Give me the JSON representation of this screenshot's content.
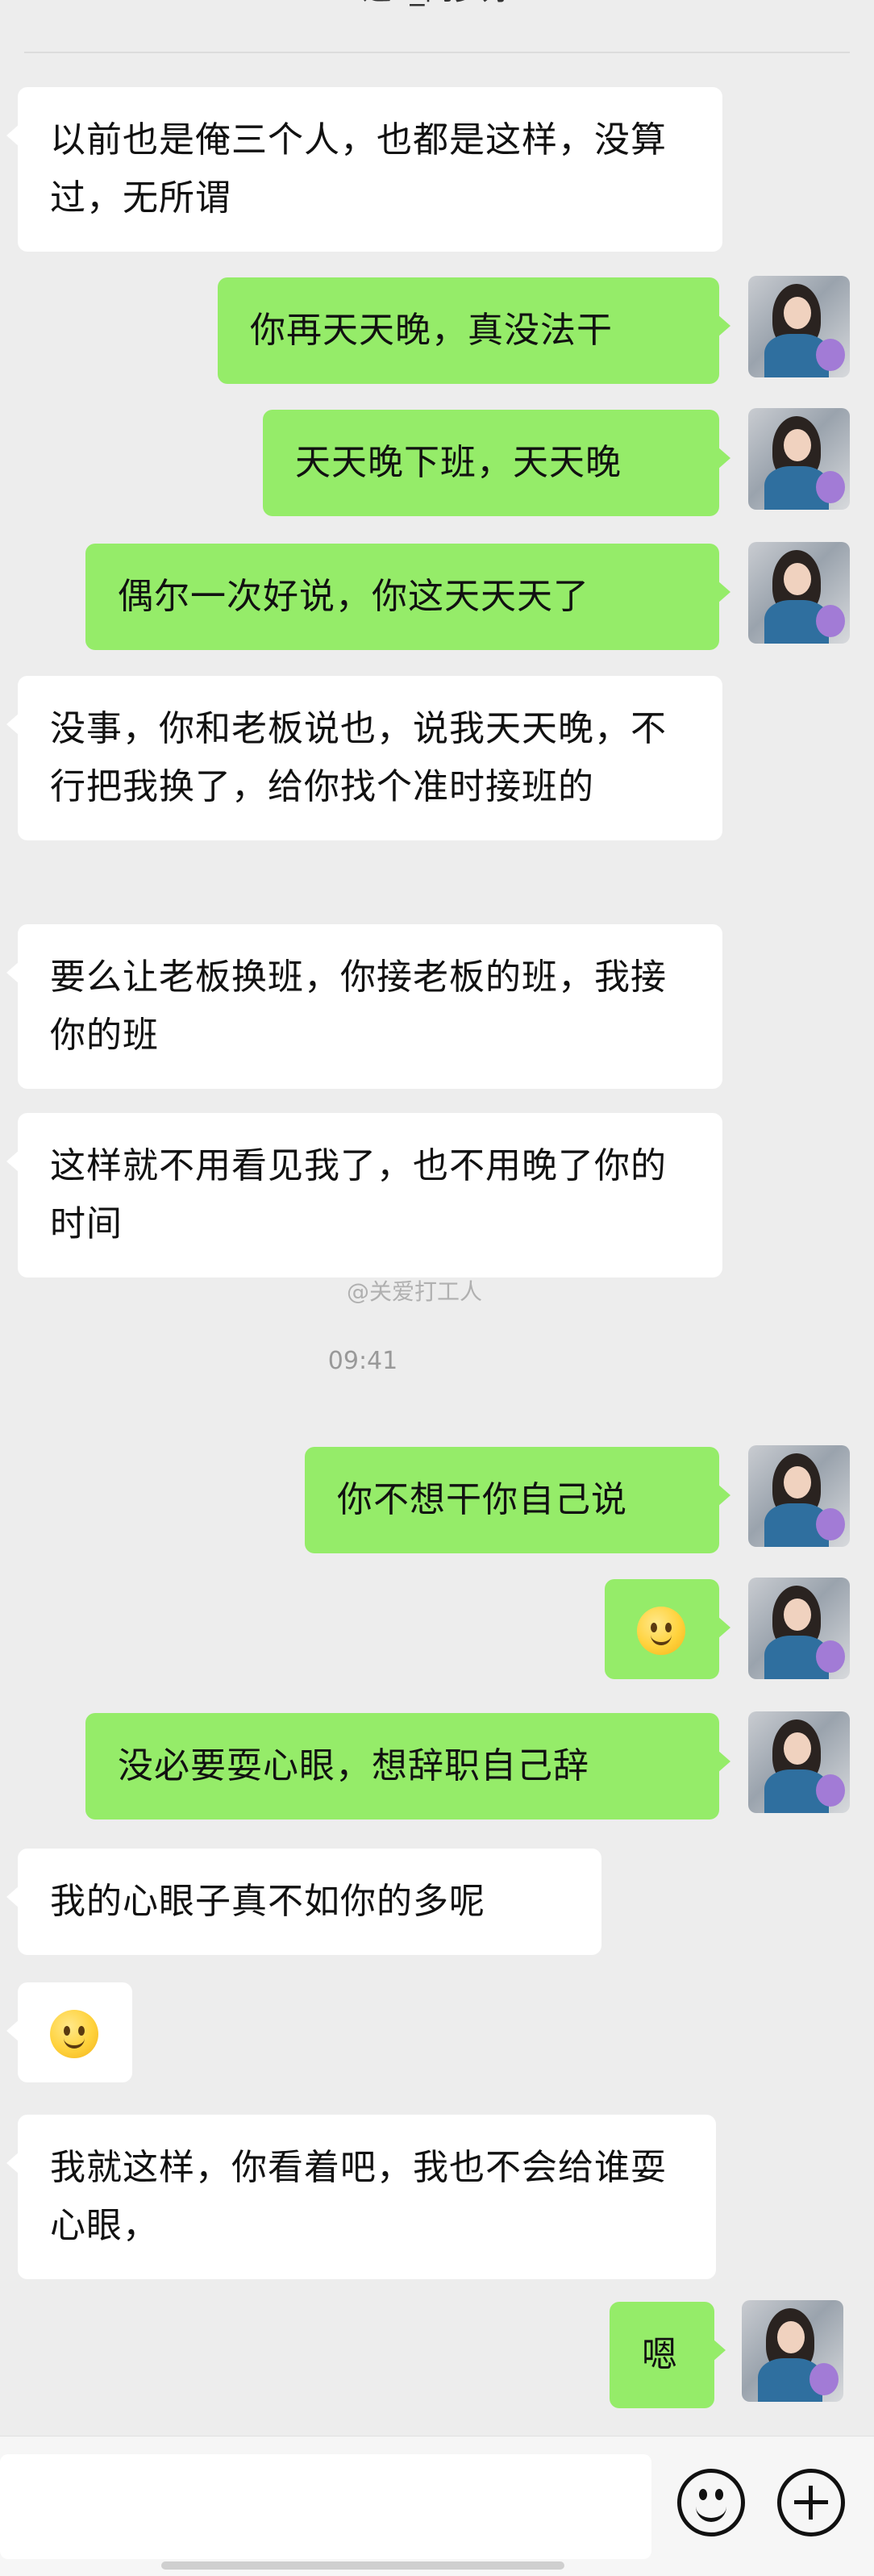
{
  "header": {
    "title": "逛S_闷梦好"
  },
  "messages": [
    {
      "side": "in",
      "text": "以前也是俺三个人，也都是这样，没算过，无所谓"
    },
    {
      "side": "out",
      "text": "你再天天晚，真没法干"
    },
    {
      "side": "out",
      "text": "天天晚下班，天天晚"
    },
    {
      "side": "out",
      "text": "偶尔一次好说，你这天天天了"
    },
    {
      "side": "in",
      "text": "没事，你和老板说也，说我天天晚，不行把我换了，给你找个准时接班的"
    },
    {
      "side": "in",
      "text": "要么让老板换班，你接老板的班，我接你的班"
    },
    {
      "side": "in",
      "text": "这样就不用看见我了，也不用晚了你的时间"
    },
    {
      "side": "out",
      "text": "你不想干你自己说"
    },
    {
      "side": "out",
      "emoji": "smile-emoji"
    },
    {
      "side": "out",
      "text": "没必要耍心眼，想辞职自己辞"
    },
    {
      "side": "in",
      "text": "我的心眼子真不如你的多呢"
    },
    {
      "side": "in",
      "emoji": "smile-emoji"
    },
    {
      "side": "in",
      "text": "我就这样，你看着吧，我也不会给谁耍心眼，"
    },
    {
      "side": "out",
      "text": "嗯"
    }
  ],
  "watermark": "@关爱打工人",
  "timestamp": "09:41",
  "colors": {
    "out_bubble": "#95ec69",
    "in_bubble": "#ffffff",
    "background": "#ededed"
  },
  "input_bar": {
    "icons": [
      "emoji-icon",
      "plus-icon"
    ]
  }
}
